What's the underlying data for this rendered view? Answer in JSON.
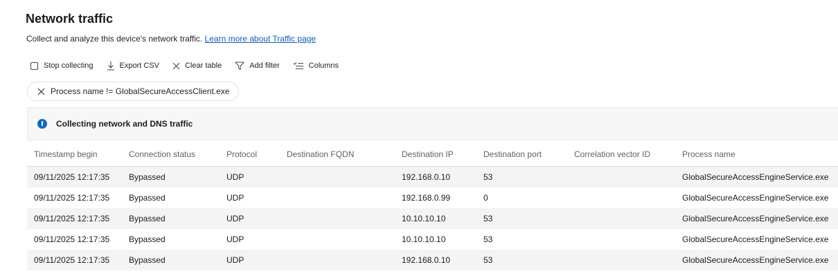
{
  "page": {
    "title": "Network traffic",
    "description": "Collect and analyze this device's network traffic.",
    "learn_more_link": "Learn more about Traffic page"
  },
  "toolbar": {
    "stop_collecting": "Stop collecting",
    "export_csv": "Export CSV",
    "clear_table": "Clear table",
    "add_filter": "Add filter",
    "columns": "Columns"
  },
  "filter_chip": {
    "label": "Process name != GlobalSecureAccessClient.exe"
  },
  "banner": {
    "text": "Collecting network and DNS traffic",
    "icon": "info-icon",
    "color": "#0f6cbd"
  },
  "table": {
    "columns": [
      "Timestamp begin",
      "Connection status",
      "Protocol",
      "Destination FQDN",
      "Destination IP",
      "Destination port",
      "Correlation vector ID",
      "Process name"
    ],
    "rows": [
      [
        "09/11/2025 12:17:35",
        "Bypassed",
        "UDP",
        "",
        "192.168.0.10",
        "53",
        "",
        "GlobalSecureAccessEngineService.exe"
      ],
      [
        "09/11/2025 12:17:35",
        "Bypassed",
        "UDP",
        "",
        "192.168.0.99",
        "0",
        "",
        "GlobalSecureAccessEngineService.exe"
      ],
      [
        "09/11/2025 12:17:35",
        "Bypassed",
        "UDP",
        "",
        "10.10.10.10",
        "53",
        "",
        "GlobalSecureAccessEngineService.exe"
      ],
      [
        "09/11/2025 12:17:35",
        "Bypassed",
        "UDP",
        "",
        "10.10.10.10",
        "53",
        "",
        "GlobalSecureAccessEngineService.exe"
      ],
      [
        "09/11/2025 12:17:35",
        "Bypassed",
        "UDP",
        "",
        "192.168.0.10",
        "53",
        "",
        "GlobalSecureAccessEngineService.exe"
      ]
    ]
  }
}
